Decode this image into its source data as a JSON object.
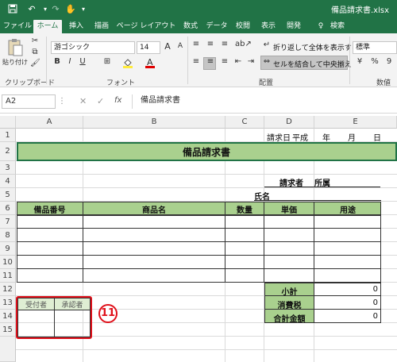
{
  "window": {
    "title": "備品請求書.xlsx",
    "accent": "#217346"
  },
  "quick_access": {
    "save_icon": "save-icon",
    "undo_icon": "undo-icon",
    "redo_icon": "redo-icon",
    "touch_icon": "touch-mode-icon"
  },
  "ribbon_tabs": [
    "ファイル",
    "ホーム",
    "挿入",
    "描画",
    "ページ レイアウト",
    "数式",
    "データ",
    "校閲",
    "表示",
    "開発",
    "検索"
  ],
  "ribbon": {
    "paste_label": "貼り付け",
    "clipboard_label": "クリップボード",
    "font_name": "游ゴシック",
    "font_size": "14",
    "font_label": "フォント",
    "wrap_text": "折り返して全体を表示する",
    "merge_center": "セルを結合して中央揃え",
    "alignment_label": "配置",
    "number_format": "標準",
    "number_label": "数値",
    "currency_sym": "¥",
    "percent_sym": "%",
    "comma_sym": "9"
  },
  "formula_bar": {
    "name_box": "A2",
    "fx": "fx",
    "content": "備品請求書"
  },
  "columns": [
    "A",
    "B",
    "C",
    "D",
    "E"
  ],
  "rows": [
    "1",
    "2",
    "3",
    "4",
    "5",
    "6",
    "7",
    "8",
    "9",
    "10",
    "11",
    "12",
    "13",
    "14",
    "15"
  ],
  "sheet": {
    "row1": {
      "d": "請求日",
      "d2": "平成",
      "e1": "年",
      "e2": "月",
      "e3": "日"
    },
    "title": "備品請求書",
    "requester_label": "請求者",
    "affiliation": "所属",
    "name_label": "氏名",
    "headers": [
      "備品番号",
      "商品名",
      "数量",
      "単価",
      "用途"
    ],
    "subtotal_label": "小計",
    "tax_label": "消費税",
    "total_label": "合計金額",
    "subtotal": "0",
    "tax": "0",
    "total": "0",
    "receiver": "受付者",
    "approver": "承認者",
    "annotation": "11"
  }
}
